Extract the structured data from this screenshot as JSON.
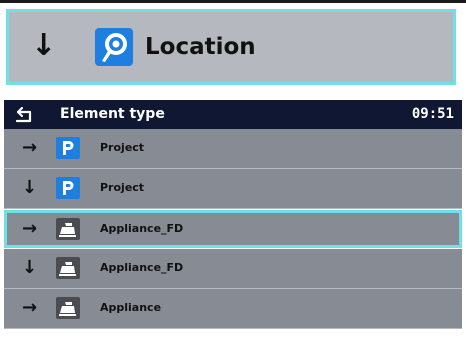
{
  "header": {
    "arrow": "↓",
    "icon": "location-icon",
    "title": "Location"
  },
  "bar": {
    "back_icon": "back-arrow-icon",
    "title": "Element type",
    "time": "09:51"
  },
  "rows": [
    {
      "arrow": "→",
      "icon": "project-icon",
      "name": "Project",
      "selected": false
    },
    {
      "arrow": "↓",
      "icon": "project-icon",
      "name": "Project",
      "selected": false
    },
    {
      "arrow": "→",
      "icon": "appliance-icon",
      "name": "Appliance_FD",
      "selected": true
    },
    {
      "arrow": "↓",
      "icon": "appliance-icon",
      "name": "Appliance_FD",
      "selected": false
    },
    {
      "arrow": "→",
      "icon": "appliance-icon",
      "name": "Appliance",
      "selected": false
    }
  ],
  "colors": {
    "accent": "#6fe0e6",
    "bar": "#101733",
    "row": "#878b94",
    "header": "#b6b8bf",
    "icon_blue": "#1f7fe0"
  }
}
